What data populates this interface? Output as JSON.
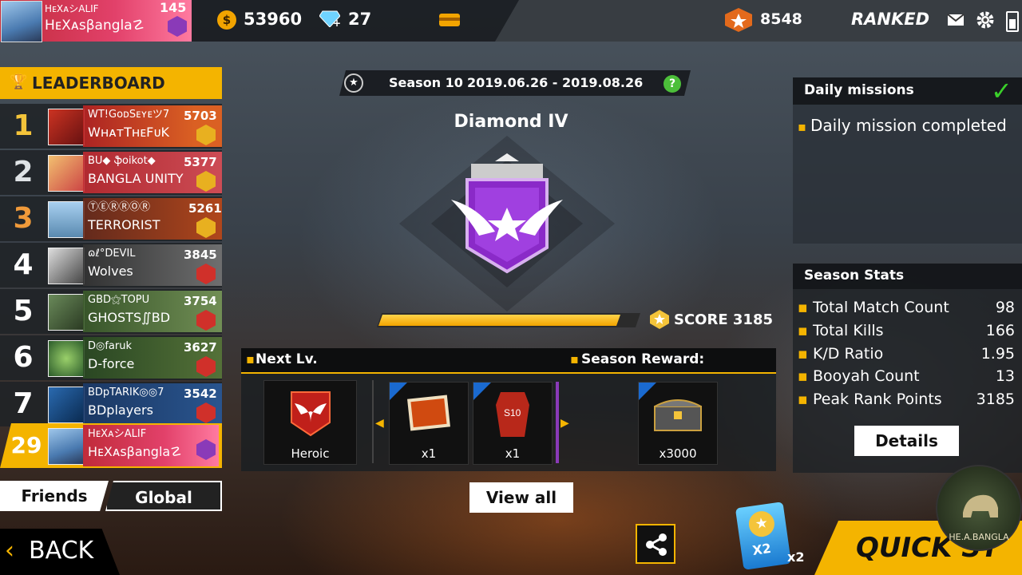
{
  "player": {
    "name_small": "HᴇXᴀシALIF",
    "level": "145",
    "name": "HᴇXᴀsβangla☡"
  },
  "currency": {
    "gold": "53960",
    "diamonds": "27"
  },
  "rank_points": "8548",
  "mode": "RANKED",
  "leaderboard": {
    "title": "LEADERBOARD",
    "rows": [
      {
        "rank": "1",
        "name": "WT!GᴏᴅSᴇʏᴇツ7",
        "guild": "WʜᴀᴛTʜᴇFᴜK",
        "score": "5703"
      },
      {
        "rank": "2",
        "name": "BU◆ ֆoikot◆",
        "guild": "BANGLA UNITY",
        "score": "5377"
      },
      {
        "rank": "3",
        "name": "ⓉⒺⓇⓇⓄⓇ",
        "guild": "TERRORIST",
        "score": "5261"
      },
      {
        "rank": "4",
        "name": "ɷℓ°DEVIL",
        "guild": "Wolves",
        "score": "3845"
      },
      {
        "rank": "5",
        "name": "GBD⚝TOPU",
        "guild": "GHOSTS∬BD",
        "score": "3754"
      },
      {
        "rank": "6",
        "name": "D◎faruk",
        "guild": "D-force",
        "score": "3627"
      },
      {
        "rank": "7",
        "name": "BDpTARIK◎◎7",
        "guild": "BDplayers",
        "score": "3542"
      }
    ],
    "self": {
      "rank": "29",
      "name": "HᴇXᴀシALIF",
      "guild": "HᴇXᴀsβangla☡"
    },
    "tabs": [
      "Friends",
      "Global"
    ]
  },
  "season": {
    "label": "Season 10",
    "dates": "2019.06.26 - 2019.08.26",
    "help": "?"
  },
  "rank_title": "Diamond IV",
  "score": {
    "label": "SCORE 3185",
    "progress": 0.93
  },
  "next_level": {
    "title": "Next Lv.",
    "tier": "Heroic"
  },
  "season_reward": {
    "title": "Season Reward:",
    "items": [
      "x1",
      "x1"
    ],
    "reward_qty": "x3000"
  },
  "view_all": "View all",
  "daily": {
    "title": "Daily missions",
    "item": "Daily mission completed"
  },
  "season_stats": {
    "title": "Season Stats",
    "rows": [
      {
        "label": "Total Match Count",
        "value": "98"
      },
      {
        "label": "Total Kills",
        "value": "166"
      },
      {
        "label": "K/D Ratio",
        "value": "1.95"
      },
      {
        "label": "Booyah Count",
        "value": "13"
      },
      {
        "label": "Peak Rank Points",
        "value": "3185"
      }
    ],
    "details": "Details"
  },
  "back": "BACK",
  "boost": {
    "badge": "X2",
    "count": "x2"
  },
  "quick_start": "QUICK ST",
  "watermark": "HE.A.BANGLA"
}
